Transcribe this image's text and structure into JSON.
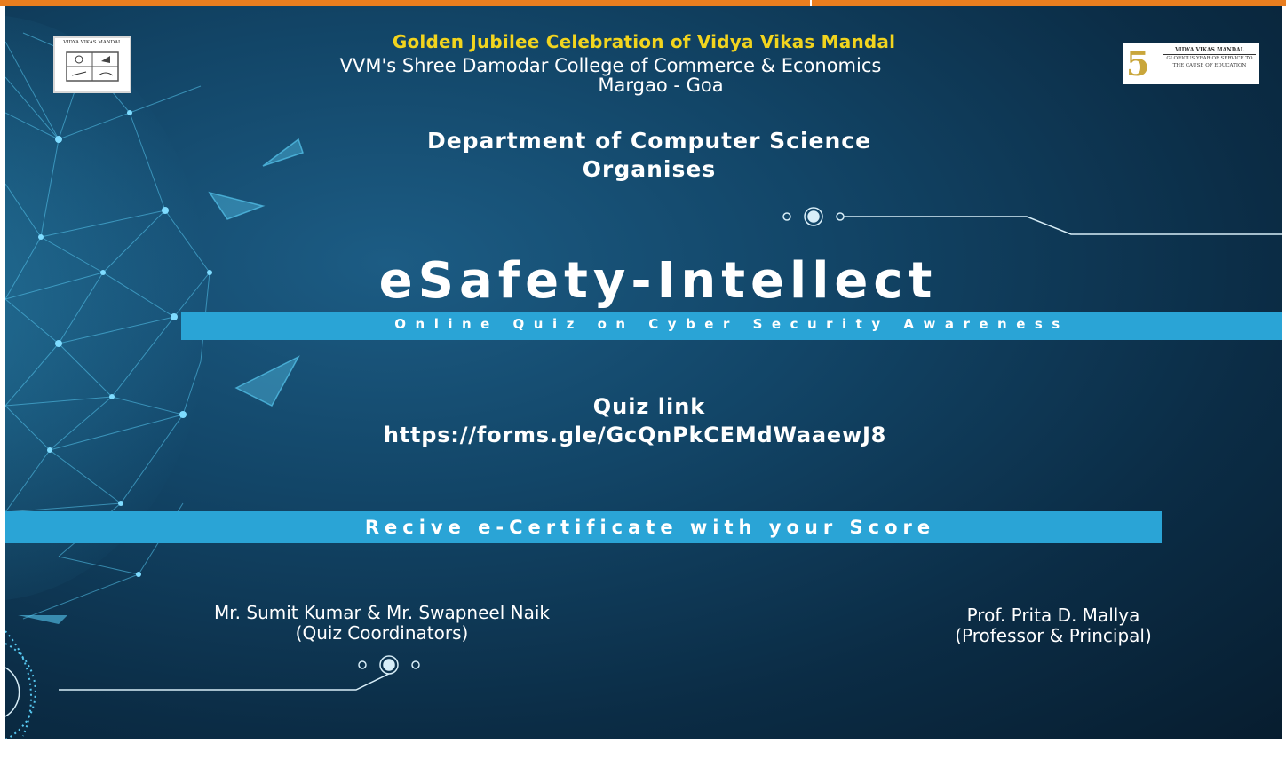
{
  "colors": {
    "top_bar": "#e97e1f",
    "background_dark": "#0b2c45",
    "accent_band": "#2aa4d6",
    "header_highlight": "#f2d41e",
    "text": "#ffffff"
  },
  "logos": {
    "left_caption": "VIDYA VIKAS MANDAL",
    "right_numeral": "5",
    "right_top": "VIDYA VIKAS MANDAL",
    "right_text": "GLORIOUS YEAR OF SERVICE TO THE CAUSE OF EDUCATION"
  },
  "header": {
    "line1": "Golden Jubilee Celebration of Vidya Vikas Mandal",
    "line2": "VVM's Shree Damodar College of Commerce & Economics",
    "line3": "Margao - Goa"
  },
  "department": {
    "name": "Department of Computer Science",
    "action": "Organises"
  },
  "event": {
    "title": "eSafety-Intellect",
    "subtitle": "Online Quiz on Cyber Security Awareness"
  },
  "quiz": {
    "label": "Quiz link",
    "url": "https://forms.gle/GcQnPkCEMdWaaewJ8"
  },
  "certificate": {
    "text": "Recive e-Certificate with your Score"
  },
  "coordinators": {
    "names": "Mr. Sumit Kumar & Mr. Swapneel Naik",
    "role": "(Quiz Coordinators)"
  },
  "principal": {
    "name": "Prof. Prita D. Mallya",
    "role": "(Professor & Principal)"
  }
}
